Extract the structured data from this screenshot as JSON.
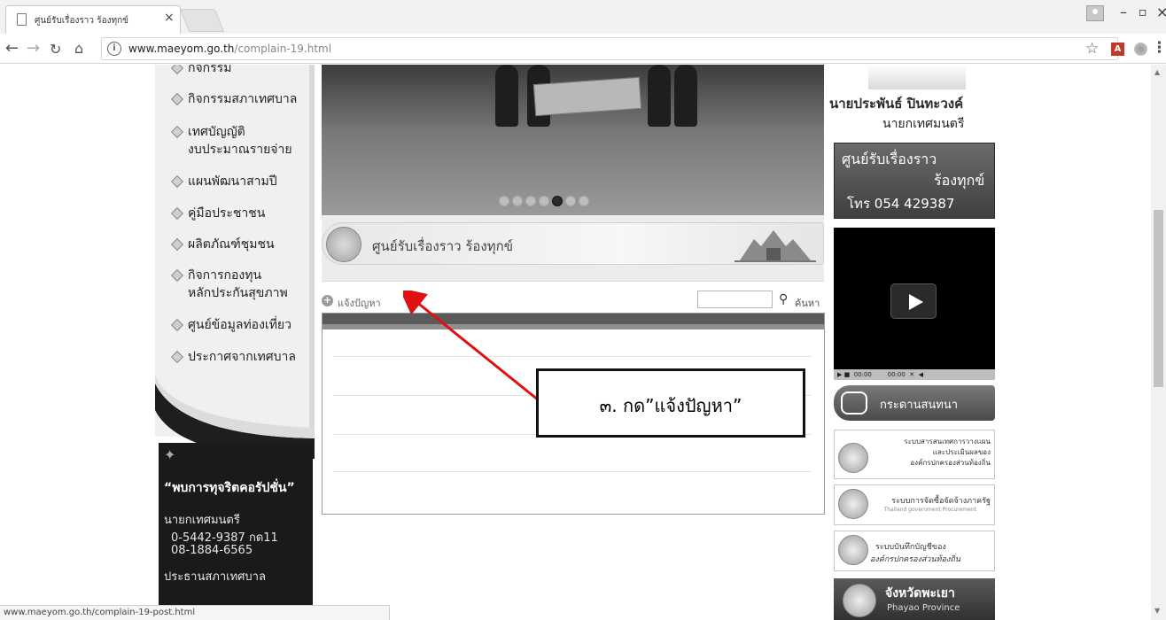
{
  "browser": {
    "tab_title": "ศูนย์รับเรื่องราว ร้องทุกข์",
    "tab_close": "×",
    "url_host": "www.maeyom.go.th",
    "url_path": "/complain-19.html",
    "status_url": "www.maeyom.go.th/complain-19-post.html",
    "win_minimize": "–",
    "win_maximize": "▫",
    "win_close": "×"
  },
  "sidebar": {
    "items": [
      {
        "label": "กิจกรรม"
      },
      {
        "label": "กิจกรรมสภาเทศบาล"
      },
      {
        "label": "เทศบัญญัติ"
      },
      {
        "label": "งบประมาณรายจ่าย"
      },
      {
        "label": "แผนพัฒนาสามปี"
      },
      {
        "label": "คู่มือประชาชน"
      },
      {
        "label": "ผลิตภัณฑ์ชุมชน"
      },
      {
        "label": "กิจการกองทุน"
      },
      {
        "label": "หลักประกันสุขภาพ"
      },
      {
        "label": "ศูนย์ข้อมูลท่องเที่ยว"
      },
      {
        "label": "ประกาศจากเทศบาล"
      }
    ],
    "anti_corruption": {
      "title": "“พบการทุจริตคอรัปชั่น”",
      "mayor_label": "นายกเทศมนตรี",
      "phone1": "0-5442-9387 กด11",
      "phone2": "08-1884-6565",
      "council_label": "ประธานสภาเทศบาล"
    }
  },
  "main": {
    "section_title": "ศูนย์รับเรื่องราว ร้องทุกข์",
    "report_link": "แจ้งปัญหา",
    "search_label": "ค้นหา",
    "search_value": "",
    "callout": "๓. กด”แจ้งปัญหา”"
  },
  "right": {
    "mayor_name": "นายประพันธ์ ปินทะวงค์",
    "mayor_position": "นายกเทศมนตรี",
    "complaint_line1": "ศูนย์รับเรื่องราว",
    "complaint_line2": "ร้องทุกข์",
    "complaint_phone": "โทร 054 429387",
    "video_controls": "▶ ■  00:00        00:00  ✕  ◀",
    "board_label": "กระดานสนทนา",
    "sys1_line1": "ระบบสารสนเทศการวางแผน",
    "sys1_line2": "และประเมินผลของ",
    "sys1_line3": "องค์กรปกครองส่วนท้องถิ่น",
    "sys2_line1": "ระบบการจัดซื้อจัดจ้างภาครัฐ",
    "sys2_line2": "Thailand government Procurement",
    "sys3_line1": "ระบบบันทึกบัญชีของ",
    "sys3_line2": "องค์กรปกครองส่วนท้องถิ่น",
    "province_title": "จังหวัดพะเยา",
    "province_sub": "Phayao Province"
  },
  "colors": {
    "arrow": "#e01010",
    "callout_border": "#111111"
  }
}
